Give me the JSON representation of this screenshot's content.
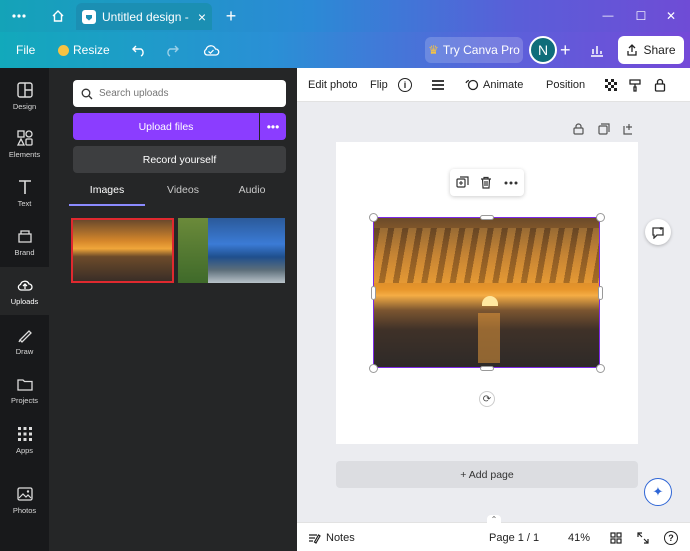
{
  "window": {
    "menu_icon": "more-horizontal-icon",
    "tab_title": "Untitled design - In...",
    "tab_close": "×",
    "new_tab": "+",
    "minimize": "—",
    "maximize": "☐",
    "close": "✕"
  },
  "header": {
    "file_label": "File",
    "resize_label": "Resize",
    "undo_icon": "undo-icon",
    "redo_icon": "redo-icon",
    "cloud_icon": "cloud-saved-icon",
    "try_label": "Try Canva Pro",
    "avatar_initial": "N",
    "add_label": "+",
    "share_label": "Share"
  },
  "nav": {
    "items": [
      {
        "label": "Design",
        "icon": "design-icon"
      },
      {
        "label": "Elements",
        "icon": "elements-icon"
      },
      {
        "label": "Text",
        "icon": "text-icon"
      },
      {
        "label": "Brand",
        "icon": "brand-icon"
      },
      {
        "label": "Uploads",
        "icon": "upload-icon"
      },
      {
        "label": "Draw",
        "icon": "draw-icon"
      },
      {
        "label": "Projects",
        "icon": "folder-icon"
      },
      {
        "label": "Apps",
        "icon": "apps-grid-icon"
      },
      {
        "label": "Photos",
        "icon": "photos-icon"
      }
    ],
    "active": "Uploads"
  },
  "panel": {
    "search_placeholder": "Search uploads",
    "upload_label": "Upload files",
    "more_label": "•••",
    "record_label": "Record yourself",
    "tabs": [
      "Images",
      "Videos",
      "Audio"
    ],
    "active_tab": "Images"
  },
  "toolbar": {
    "edit_photo": "Edit photo",
    "flip": "Flip",
    "info": "i",
    "animate": "Animate",
    "position": "Position"
  },
  "canvas": {
    "add_page": "+ Add page"
  },
  "bottom": {
    "notes": "Notes",
    "page_indicator": "Page 1 / 1",
    "zoom": "41%",
    "help": "?"
  },
  "colors": {
    "accent": "#8b3dff",
    "selection": "#7d2ae8",
    "thumb_selected_border": "#e0292f"
  }
}
